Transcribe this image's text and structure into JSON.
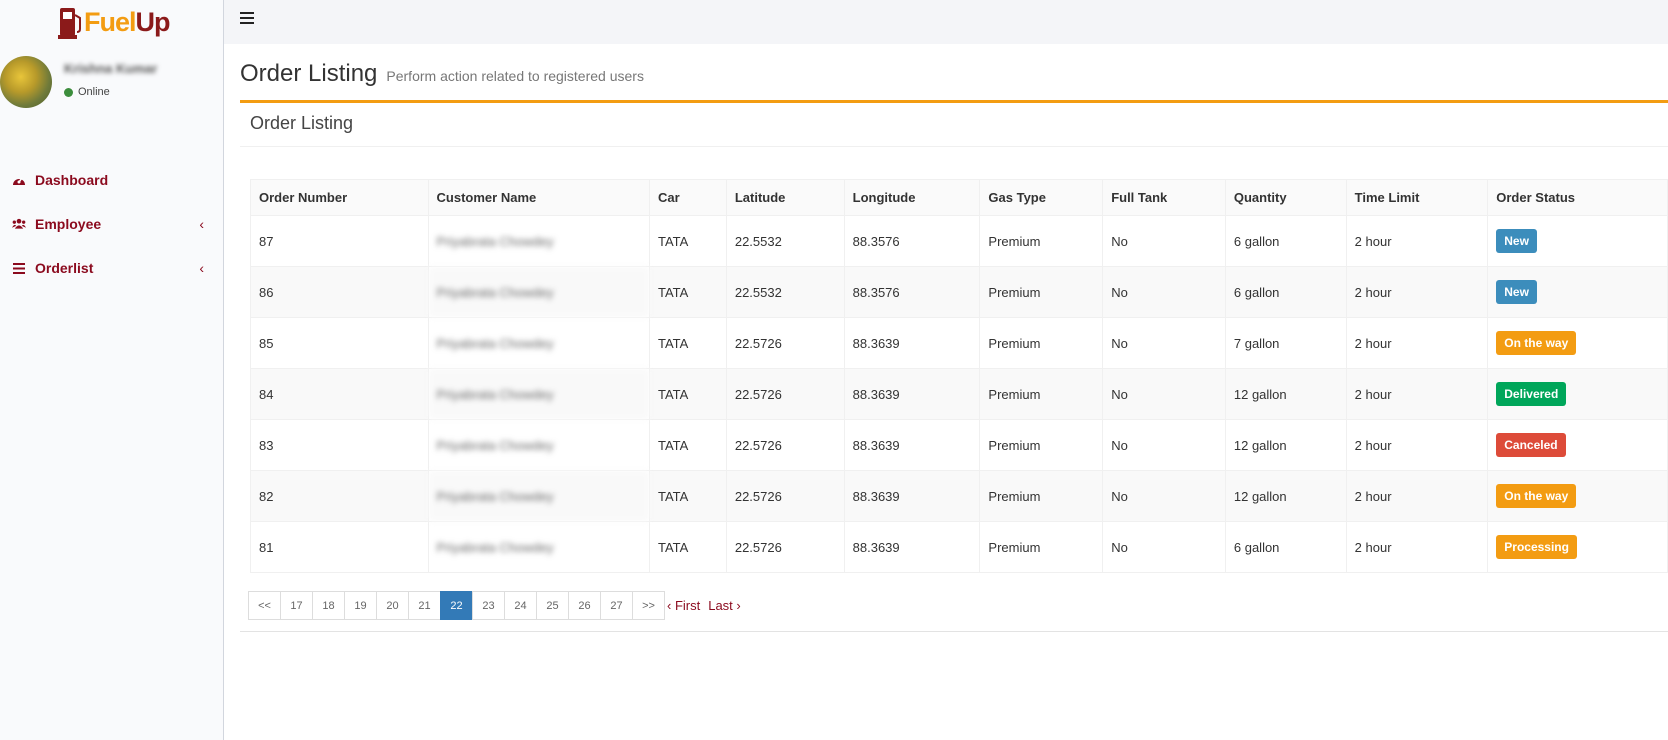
{
  "brand": {
    "part1": "Fuel",
    "part2": "Up",
    "accent": "#f39c12",
    "primary": "#8b1a1a"
  },
  "user": {
    "name": "Krishna Kumar",
    "status": "Online"
  },
  "sidebar": {
    "items": [
      {
        "label": "Dashboard",
        "icon": "dashboard-icon",
        "chevron": ""
      },
      {
        "label": "Employee",
        "icon": "users-icon",
        "chevron": "‹"
      },
      {
        "label": "Orderlist",
        "icon": "list-icon",
        "chevron": "‹"
      }
    ]
  },
  "header": {
    "title": "Order Listing",
    "subtitle": "Perform action related to registered users"
  },
  "box": {
    "title": "Order Listing"
  },
  "table": {
    "columns": [
      "Order Number",
      "Customer Name",
      "Car",
      "Latitude",
      "Longitude",
      "Gas Type",
      "Full Tank",
      "Quantity",
      "Time Limit",
      "Order Status"
    ],
    "rows": [
      {
        "order": "87",
        "customer": "Priyabrata Chowdey",
        "car": "TATA",
        "lat": "22.5532",
        "lon": "88.3576",
        "gas": "Premium",
        "full": "No",
        "qty": "6 gallon",
        "time": "2 hour",
        "status": "New",
        "status_color": "#3c8dbc"
      },
      {
        "order": "86",
        "customer": "Priyabrata Chowdey",
        "car": "TATA",
        "lat": "22.5532",
        "lon": "88.3576",
        "gas": "Premium",
        "full": "No",
        "qty": "6 gallon",
        "time": "2 hour",
        "status": "New",
        "status_color": "#3c8dbc"
      },
      {
        "order": "85",
        "customer": "Priyabrata Chowdey",
        "car": "TATA",
        "lat": "22.5726",
        "lon": "88.3639",
        "gas": "Premium",
        "full": "No",
        "qty": "7 gallon",
        "time": "2 hour",
        "status": "On the way",
        "status_color": "#f39c12"
      },
      {
        "order": "84",
        "customer": "Priyabrata Chowdey",
        "car": "TATA",
        "lat": "22.5726",
        "lon": "88.3639",
        "gas": "Premium",
        "full": "No",
        "qty": "12 gallon",
        "time": "2 hour",
        "status": "Delivered",
        "status_color": "#00a65a"
      },
      {
        "order": "83",
        "customer": "Priyabrata Chowdey",
        "car": "TATA",
        "lat": "22.5726",
        "lon": "88.3639",
        "gas": "Premium",
        "full": "No",
        "qty": "12 gallon",
        "time": "2 hour",
        "status": "Canceled",
        "status_color": "#dd4b39"
      },
      {
        "order": "82",
        "customer": "Priyabrata Chowdey",
        "car": "TATA",
        "lat": "22.5726",
        "lon": "88.3639",
        "gas": "Premium",
        "full": "No",
        "qty": "12 gallon",
        "time": "2 hour",
        "status": "On the way",
        "status_color": "#f39c12"
      },
      {
        "order": "81",
        "customer": "Priyabrata Chowdey",
        "car": "TATA",
        "lat": "22.5726",
        "lon": "88.3639",
        "gas": "Premium",
        "full": "No",
        "qty": "6 gallon",
        "time": "2 hour",
        "status": "Processing",
        "status_color": "#f39c12"
      }
    ]
  },
  "pagination": {
    "pages": [
      "<<",
      "17",
      "18",
      "19",
      "20",
      "21",
      "22",
      "23",
      "24",
      "25",
      "26",
      "27",
      ">>"
    ],
    "active": "22",
    "first": "‹ First",
    "last": "Last ›"
  }
}
